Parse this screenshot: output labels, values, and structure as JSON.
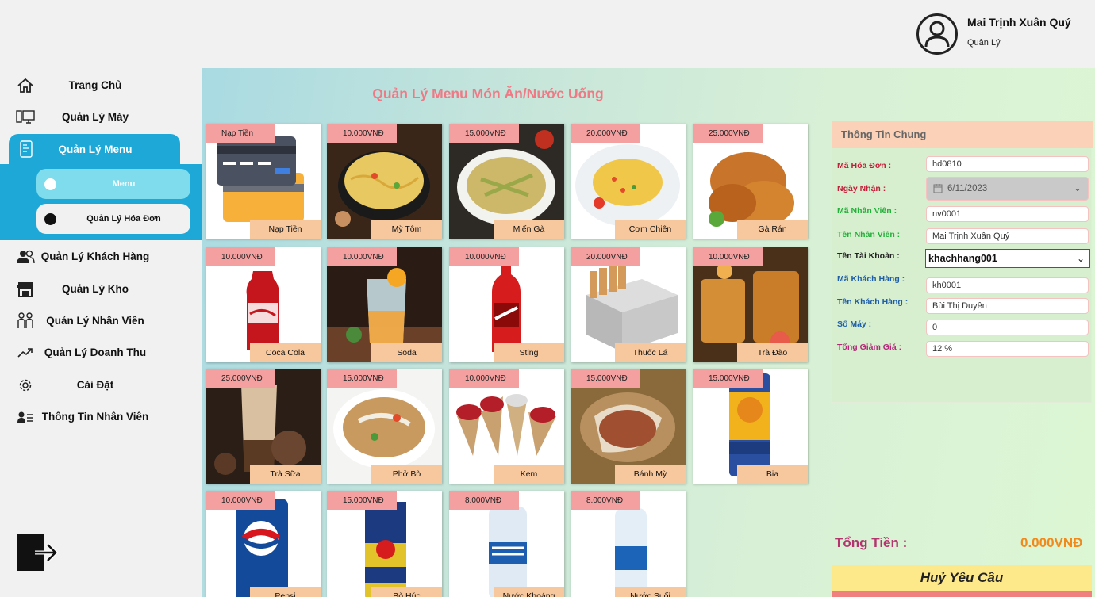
{
  "header": {
    "user_name": "Mai Trịnh Xuân Quý",
    "user_role": "Quản Lý"
  },
  "sidebar": {
    "items": [
      {
        "label": "Trang Chủ",
        "icon": "home-icon"
      },
      {
        "label": "Quản Lý Máy",
        "icon": "computer-icon"
      },
      {
        "label": "Quản Lý Menu",
        "icon": "menu-book-icon"
      },
      {
        "label": "Quản Lý Khách Hàng",
        "icon": "users-icon"
      },
      {
        "label": "Quản Lý Kho",
        "icon": "store-icon"
      },
      {
        "label": "Quản Lý Nhân Viên",
        "icon": "staff-icon"
      },
      {
        "label": "Quản Lý Doanh Thu",
        "icon": "trend-up-icon"
      },
      {
        "label": "Cài Đặt",
        "icon": "gear-icon"
      },
      {
        "label": "Thông Tin Nhân Viên",
        "icon": "id-card-icon"
      }
    ],
    "sub_items": [
      {
        "label": "Menu",
        "selected": true
      },
      {
        "label": "Quản Lý Hóa Đơn",
        "selected": false
      }
    ]
  },
  "main": {
    "title": "Quản Lý Menu Món Ăn/Nước Uống",
    "products": [
      {
        "price": "Nạp Tiền",
        "name": "Nạp Tiền",
        "art": "card"
      },
      {
        "price": "10.000VNĐ",
        "name": "Mỳ Tôm",
        "art": "noodle"
      },
      {
        "price": "15.000VNĐ",
        "name": "Miến Gà",
        "art": "soup"
      },
      {
        "price": "20.000VNĐ",
        "name": "Cơm Chiên",
        "art": "rice"
      },
      {
        "price": "25.000VNĐ",
        "name": "Gà Rán",
        "art": "chicken"
      },
      {
        "price": "10.000VNĐ",
        "name": "Coca Cola",
        "art": "coke"
      },
      {
        "price": "10.000VNĐ",
        "name": "Soda",
        "art": "soda"
      },
      {
        "price": "10.000VNĐ",
        "name": "Sting",
        "art": "sting"
      },
      {
        "price": "20.000VNĐ",
        "name": "Thuốc Lá",
        "art": "cigarette"
      },
      {
        "price": "10.000VNĐ",
        "name": "Trà Đào",
        "art": "peachtea"
      },
      {
        "price": "25.000VNĐ",
        "name": "Trà Sữa",
        "art": "milktea"
      },
      {
        "price": "15.000VNĐ",
        "name": "Phở Bò",
        "art": "pho"
      },
      {
        "price": "10.000VNĐ",
        "name": "Kem",
        "art": "icecream"
      },
      {
        "price": "15.000VNĐ",
        "name": "Bánh Mỳ",
        "art": "bread"
      },
      {
        "price": "15.000VNĐ",
        "name": "Bia",
        "art": "beer"
      },
      {
        "price": "10.000VNĐ",
        "name": "Pepsi",
        "art": "pepsi"
      },
      {
        "price": "15.000VNĐ",
        "name": "Bò Húc",
        "art": "redbull"
      },
      {
        "price": "8.000VNĐ",
        "name": "Nước Khoáng",
        "art": "pocari"
      },
      {
        "price": "8.000VNĐ",
        "name": "Nước Suối",
        "art": "water"
      }
    ]
  },
  "info": {
    "title": "Thông Tin Chung",
    "fields": {
      "invoice_id": {
        "label": "Mã Hóa Đơn :",
        "value": "hd0810"
      },
      "date": {
        "label": "Ngày Nhận :",
        "value": "6/11/2023"
      },
      "staff_id": {
        "label": "Mã Nhân Viên :",
        "value": "nv0001"
      },
      "staff_name": {
        "label": "Tên Nhân Viên :",
        "value": "Mai Trịnh Xuân Quý"
      },
      "account": {
        "label": "Tên Tài Khoản :",
        "value": "khachhang001"
      },
      "customer_id": {
        "label": "Mã Khách Hàng :",
        "value": "kh0001"
      },
      "customer_name": {
        "label": "Tên Khách Hàng :",
        "value": "Bùi Thị Duyên"
      },
      "machine_no": {
        "label": "Số Máy :",
        "value": "0"
      },
      "discount": {
        "label": "Tổng Giảm Giá :",
        "value": "12 %"
      }
    },
    "total_label": "Tổng Tiền :",
    "total_value": "0.000VNĐ",
    "cancel_label": "Huỷ Yêu Cầu"
  },
  "colors": {
    "accent": "#1ea8d8",
    "title": "#ef7a86",
    "price_tag": "#f4a0a0",
    "name_tag": "#f7c89e",
    "total_value": "#f2891a"
  }
}
